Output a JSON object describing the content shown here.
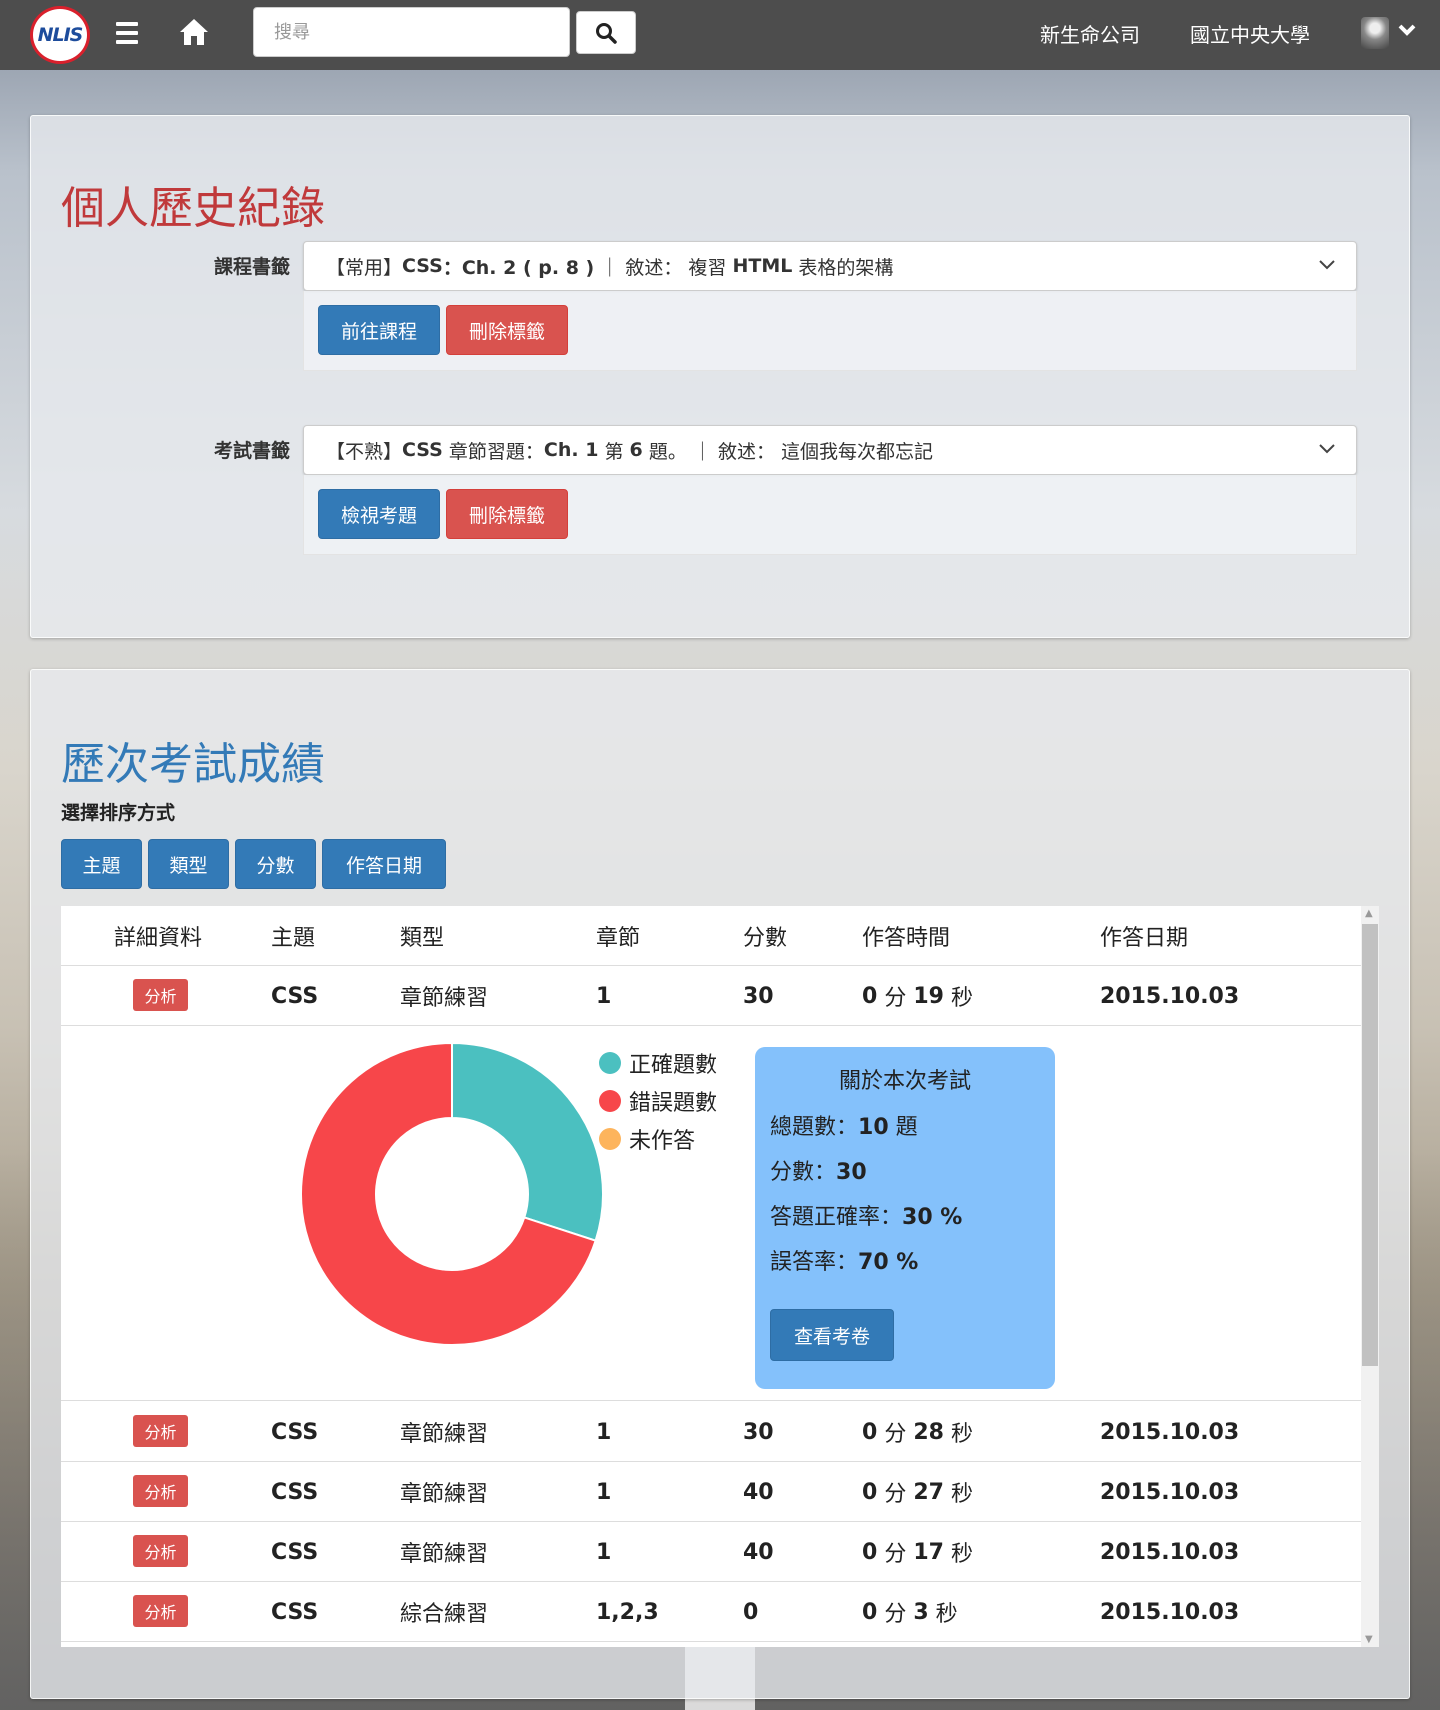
{
  "nav": {
    "logo_text": "NLIS",
    "search_placeholder": "搜尋",
    "links": [
      "新生命公司",
      "國立中央大學"
    ]
  },
  "bookmarks": {
    "title": "個人歷史紀錄",
    "course": {
      "label": "課程書籤",
      "tag": "【常用】",
      "subject": "CSS",
      "chapter": "：Ch. 2 ( p. 8 )",
      "sep": "｜",
      "desc_label": "敘述：",
      "desc_prefix": "複習",
      "desc_bold": "HTML",
      "desc_suffix": "表格的架構",
      "go_button": "前往課程",
      "delete_button": "刪除標籤"
    },
    "exam": {
      "label": "考試書籤",
      "tag": "【不熟】",
      "subject": "CSS",
      "chapter_pre": "章節習題：",
      "chapter": "Ch. 1",
      "q_pre": "第",
      "q_num": "6",
      "q_post": "題。",
      "sep": "｜",
      "desc_label": "敘述：",
      "desc": "這個我每次都忘記",
      "view_button": "檢視考題",
      "delete_button": "刪除標籤"
    }
  },
  "scores": {
    "title": "歷次考試成績",
    "sort_caption": "選擇排序方式",
    "sort_buttons": [
      "主題",
      "類型",
      "分數",
      "作答日期"
    ],
    "headers": [
      "詳細資料",
      "主題",
      "類型",
      "章節",
      "分數",
      "作答時間",
      "作答日期"
    ],
    "analyze_label": "分析",
    "rows": [
      {
        "topic": "CSS",
        "type": "章節練習",
        "chapter": "1",
        "score": "30",
        "time_min": "0",
        "time_sec": "19",
        "date": "2015.10.03"
      },
      {
        "topic": "CSS",
        "type": "章節練習",
        "chapter": "1",
        "score": "30",
        "time_min": "0",
        "time_sec": "28",
        "date": "2015.10.03"
      },
      {
        "topic": "CSS",
        "type": "章節練習",
        "chapter": "1",
        "score": "40",
        "time_min": "0",
        "time_sec": "27",
        "date": "2015.10.03"
      },
      {
        "topic": "CSS",
        "type": "章節練習",
        "chapter": "1",
        "score": "40",
        "time_min": "0",
        "time_sec": "17",
        "date": "2015.10.03"
      },
      {
        "topic": "CSS",
        "type": "綜合練習",
        "chapter": "1,2,3",
        "score": "0",
        "time_min": "0",
        "time_sec": "3",
        "date": "2015.10.03"
      }
    ],
    "unit_min": "分",
    "unit_sec": "秒",
    "detail": {
      "legend": [
        {
          "label": "正確題數",
          "color": "#4bc0c0"
        },
        {
          "label": "錯誤題數",
          "color": "#f7464a"
        },
        {
          "label": "未作答",
          "color": "#fdb45c"
        }
      ],
      "info_title": "關於本次考試",
      "total_label": "總題數：",
      "total_value": "10",
      "total_unit": "題",
      "score_label": "分數：",
      "score_value": "30",
      "rate_label": "答題正確率：",
      "rate_value": "30 %",
      "error_label": "誤答率：",
      "error_value": "70 %",
      "view_paper_button": "查看考卷"
    }
  },
  "chart_data": {
    "type": "pie",
    "categories": [
      "正確題數",
      "錯誤題數",
      "未作答"
    ],
    "values": [
      3,
      7,
      0
    ],
    "colors": [
      "#4bc0c0",
      "#f7464a",
      "#fdb45c"
    ]
  }
}
